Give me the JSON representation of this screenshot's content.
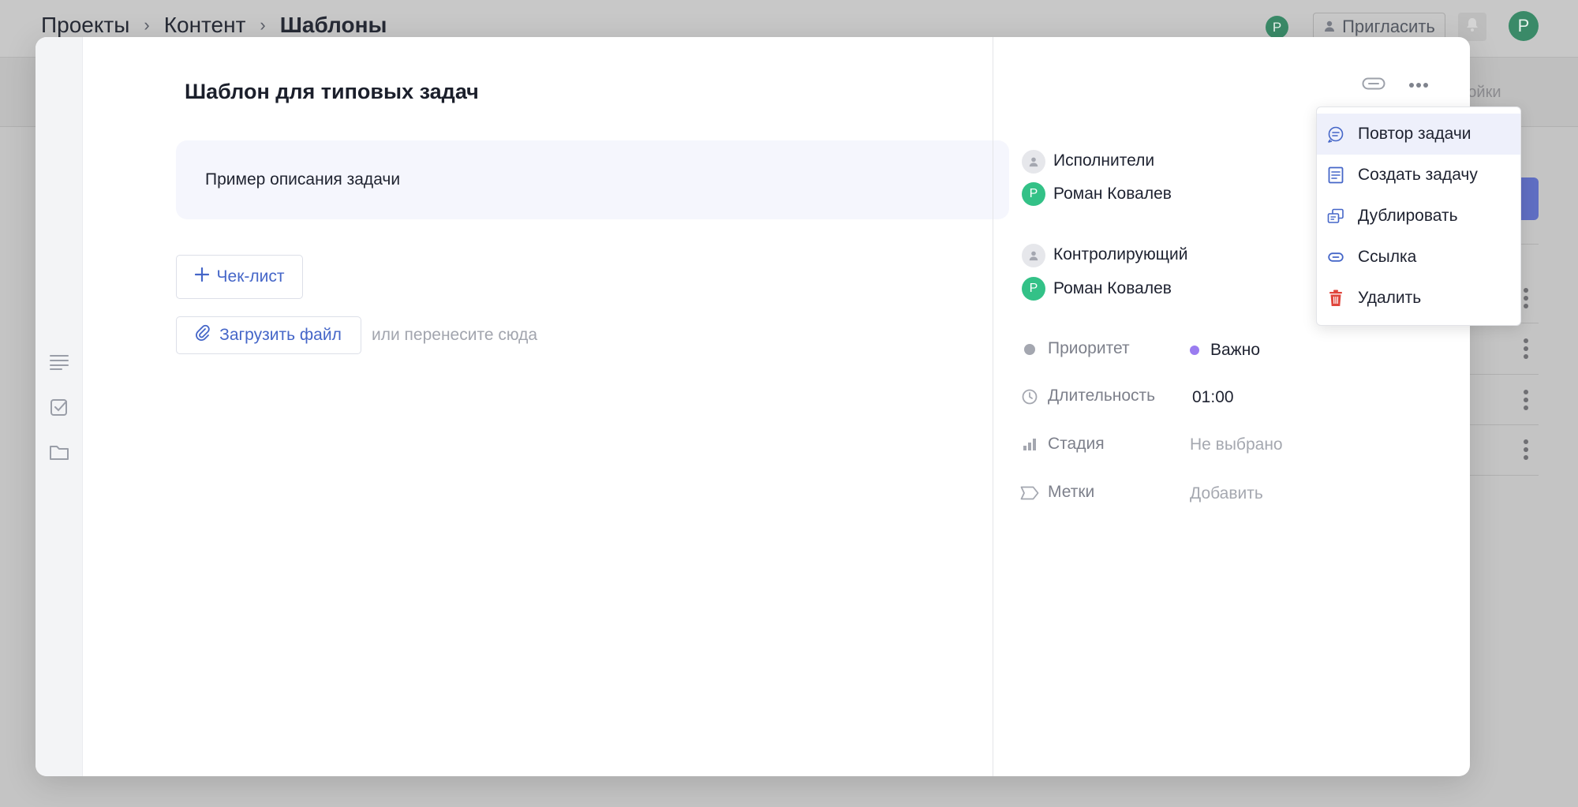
{
  "breadcrumb": {
    "items": [
      "Проекты",
      "Контент"
    ],
    "current": "Шаблоны",
    "separator": "›"
  },
  "header": {
    "invite_label": "Пригласить",
    "avatar_small_letter": "Р",
    "avatar_letter": "Р",
    "settings_partial": "тройки"
  },
  "task": {
    "title": "Шаблон для типовых задач",
    "description": "Пример описания задачи",
    "checklist_label": "Чек-лист",
    "upload_label": "Загрузить файл",
    "drop_hint": "или перенесите сюда"
  },
  "assignees": {
    "label": "Исполнители",
    "person": {
      "name": "Роман Ковалев",
      "initial": "Р"
    }
  },
  "controller": {
    "label": "Контролирующий",
    "person": {
      "name": "Роман Ковалев",
      "initial": "Р"
    }
  },
  "properties": {
    "priority": {
      "label": "Приоритет",
      "value": "Важно",
      "color": "#9a7cf0"
    },
    "duration": {
      "label": "Длительность",
      "value": "01:00"
    },
    "stage": {
      "label": "Стадия",
      "value": "Не выбрано"
    },
    "tags": {
      "label": "Метки",
      "value": "Добавить"
    }
  },
  "menu": {
    "items": [
      {
        "label": "Повтор задачи",
        "icon": "repeat-chat-icon"
      },
      {
        "label": "Создать задачу",
        "icon": "document-icon"
      },
      {
        "label": "Дублировать",
        "icon": "copy-icon"
      },
      {
        "label": "Ссылка",
        "icon": "link-icon"
      },
      {
        "label": "Удалить",
        "icon": "trash-icon"
      }
    ]
  },
  "colors": {
    "accent": "#4566c8",
    "avatar_green": "#33c187",
    "delete_red": "#e0453c",
    "menu_active_bg": "#eef0fb"
  }
}
